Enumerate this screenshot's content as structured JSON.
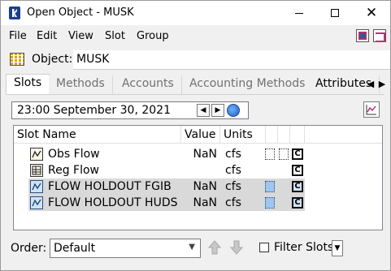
{
  "window": {
    "title": "Open Object - MUSK",
    "controls": {
      "minimize": "minimize",
      "maximize": "maximize",
      "close": "✕"
    }
  },
  "menubar": {
    "items": [
      "File",
      "Edit",
      "View",
      "Slot",
      "Group"
    ],
    "right_icons": [
      "object-view-icon",
      "exit-object-icon"
    ]
  },
  "object": {
    "label": "Object:",
    "value": "MUSK",
    "icon": "grid-object-icon"
  },
  "tabs": [
    "Slots",
    "Methods",
    "Accounts",
    "Accounting Methods",
    "Attributes"
  ],
  "tab_nav": {
    "prev": "◀",
    "next": "▶"
  },
  "timestep": {
    "value": "23:00 September 30, 2021",
    "prev": "◀",
    "next": "▶"
  },
  "table": {
    "columns": [
      "Slot Name",
      "Value",
      "Units",
      "",
      "",
      ""
    ],
    "rows": [
      {
        "name": "Obs Flow",
        "value": "NaN",
        "units": "cfs",
        "icon": "series-slot-icon",
        "flags": [
          "dotted",
          "dotted"
        ],
        "c": "C",
        "highlighted": false
      },
      {
        "name": "Reg Flow",
        "value": "",
        "units": "cfs",
        "icon": "table-slot-icon",
        "flags": [],
        "c": "C",
        "highlighted": false
      },
      {
        "name": "FLOW HOLDOUT FGIB",
        "value": "NaN",
        "units": "cfs",
        "icon": "series-slot-icon",
        "flags": [
          "blue"
        ],
        "c": "C",
        "highlighted": true
      },
      {
        "name": "FLOW HOLDOUT HUDS",
        "value": "NaN",
        "units": "cfs",
        "icon": "series-slot-icon",
        "flags": [
          "blue"
        ],
        "c": "C",
        "highlighted": true
      }
    ]
  },
  "bottom": {
    "order_label": "Order:",
    "order_value": "Default",
    "up_arrow": "🡅",
    "down_arrow": "🡇",
    "filter_label": "Filter Slots"
  },
  "colors": {
    "highlight_row": "#d9d9d9",
    "accent": "#1b3f8f"
  }
}
